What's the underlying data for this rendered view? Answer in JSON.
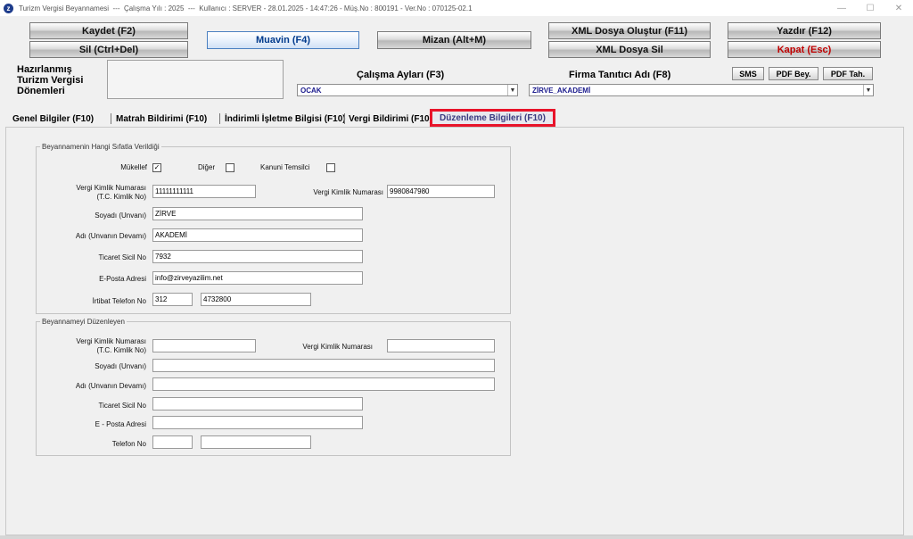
{
  "window": {
    "title": "Turizm Vergisi Beyannamesi  ---  Çalışma Yılı : 2025  ---  Kullanıcı : SERVER - 28.01.2025 - 14:47:26 - Müş.No : 800191 - Ver.No : 070125-02.1",
    "controls": {
      "minimize": "—",
      "maximize": "☐",
      "close": "✕"
    }
  },
  "toolbar": {
    "save": "Kaydet (F2)",
    "delete": "Sil (Ctrl+Del)",
    "muavin": "Muavin (F4)",
    "mizan": "Mizan (Alt+M)",
    "xml_create": "XML Dosya Oluştur (F11)",
    "xml_delete": "XML Dosya Sil",
    "print": "Yazdır (F12)",
    "close": "Kapat (Esc)"
  },
  "header": {
    "prepared_label": "Hazırlanmış\nTurizm Vergisi\nDönemleri",
    "months_title": "Çalışma Ayları (F3)",
    "months_value": "OCAK",
    "company_title": "Firma Tanıtıcı Adı (F8)",
    "company_value": "ZİRVE_AKADEMİ",
    "sms": "SMS",
    "pdf_bey": "PDF Bey.",
    "pdf_tah": "PDF Tah."
  },
  "tabs": [
    {
      "label": "Genel Bilgiler (F10)"
    },
    {
      "label": "Matrah Bildirimi (F10)"
    },
    {
      "label": "İndirimli İşletme Bilgisi (F10)"
    },
    {
      "label": "Vergi Bildirimi (F10)"
    },
    {
      "label": "Düzenleme Bilgileri (F10)"
    }
  ],
  "group1": {
    "legend": "Beyannamenin Hangi Sıfatla Verildiği",
    "mukellef_label": "Mükellef",
    "mukellef_checked": "✓",
    "diger_label": "Diğer",
    "kanuni_label": "Kanuni Temsilci",
    "vkn_tc_label": "Vergi Kimlik Numarası\n(T.C. Kimlik No)",
    "vkn_tc_value": "11111111111",
    "vkn_label": "Vergi Kimlik Numarası",
    "vkn_value": "9980847980",
    "surname_label": "Soyadı (Unvanı)",
    "surname_value": "ZİRVE",
    "name_label": "Adı (Unvanın Devamı)",
    "name_value": "AKADEMİ",
    "trade_label": "Ticaret Sicil No",
    "trade_value": "7932",
    "email_label": "E-Posta Adresi",
    "email_value": "info@zirveyazilim.net",
    "phone_label": "İrtibat Telefon No",
    "phone_area": "312",
    "phone_number": "4732800"
  },
  "group2": {
    "legend": "Beyannameyi Düzenleyen",
    "vkn_tc_label": "Vergi Kimlik Numarası\n(T.C. Kimlik No)",
    "vkn_tc_value": "",
    "vkn_label": "Vergi Kimlik Numarası",
    "vkn_value": "",
    "surname_label": "Soyadı (Unvanı)",
    "surname_value": "",
    "name_label": "Adı (Unvanın Devamı)",
    "name_value": "",
    "trade_label": "Ticaret Sicil No",
    "trade_value": "",
    "email_label": "E - Posta Adresi",
    "email_value": "",
    "phone_label": "Telefon No",
    "phone_area": "",
    "phone_number": ""
  },
  "colors": {
    "selected_tab_border": "#e8142a",
    "close_text": "#c00000",
    "combo_text": "#1a1a8c"
  }
}
